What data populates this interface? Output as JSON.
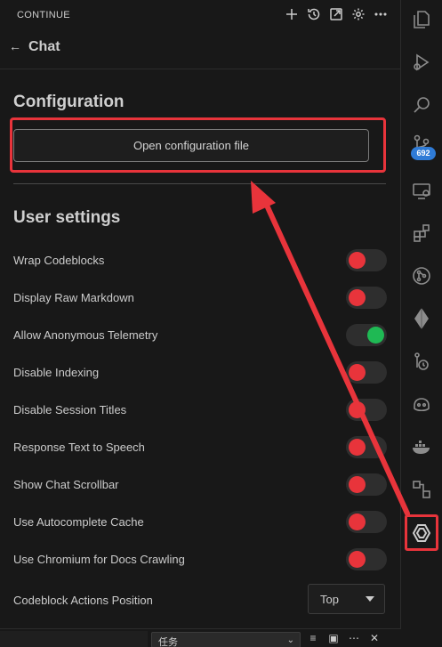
{
  "titlebar": {
    "title": "CONTINUE",
    "actions": [
      "plus-icon",
      "history-icon",
      "open-external-icon",
      "gear-icon",
      "more-icon"
    ]
  },
  "header": {
    "back_icon": "arrow-left-icon",
    "name": "Chat"
  },
  "configuration": {
    "heading": "Configuration",
    "open_button": "Open configuration file"
  },
  "user_settings": {
    "heading": "User settings",
    "items": [
      {
        "label": "Wrap Codeblocks",
        "enabled": false
      },
      {
        "label": "Display Raw Markdown",
        "enabled": false
      },
      {
        "label": "Allow Anonymous Telemetry",
        "enabled": true
      },
      {
        "label": "Disable Indexing",
        "enabled": false
      },
      {
        "label": "Disable Session Titles",
        "enabled": false
      },
      {
        "label": "Response Text to Speech",
        "enabled": false
      },
      {
        "label": "Show Chat Scrollbar",
        "enabled": false
      },
      {
        "label": "Use Autocomplete Cache",
        "enabled": false
      },
      {
        "label": "Use Chromium for Docs Crawling",
        "enabled": false
      }
    ],
    "codeblock_actions": {
      "label": "Codeblock Actions Position",
      "value": "Top"
    }
  },
  "bottom_bar": {
    "task_select": "任务"
  },
  "activity_bar": {
    "items": [
      "explorer-icon",
      "run-debug-icon",
      "search-icon",
      "source-control-icon",
      "remote-explorer-icon",
      "extensions-icon",
      "git-graph-icon",
      "diamond-icon",
      "timeline-icon",
      "copilot-icon",
      "docker-icon",
      "diagram-icon",
      "continue-icon"
    ],
    "source_control_badge": "692"
  },
  "colors": {
    "accent_red": "#e8343b",
    "toggle_on": "#1fb954",
    "badge_blue": "#2f7bd6"
  }
}
